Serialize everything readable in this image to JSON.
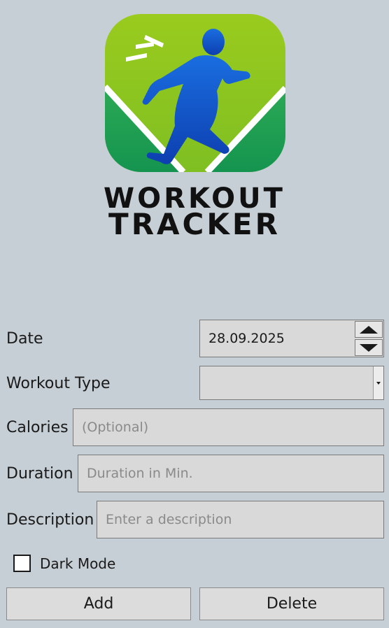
{
  "logo": {
    "line1": "WORKOUT",
    "line2": "TRACKER"
  },
  "form": {
    "date": {
      "label": "Date",
      "value": "28.09.2025"
    },
    "workout_type": {
      "label": "Workout Type",
      "value": ""
    },
    "calories": {
      "label": "Calories",
      "placeholder": "(Optional)"
    },
    "duration": {
      "label": "Duration",
      "placeholder": "Duration in Min."
    },
    "description": {
      "label": "Description",
      "placeholder": "Enter a description"
    },
    "dark_mode": {
      "label": "Dark Mode",
      "checked": false
    }
  },
  "buttons": {
    "add": "Add",
    "delete": "Delete"
  },
  "colors": {
    "background": "#c7cfd6",
    "field_bg": "#d9d9d9",
    "logo_green_light": "#8dc21f",
    "logo_green_dark": "#1fa05a",
    "logo_runner_blue": "#1358c9"
  },
  "icons": {
    "logo": "runner-icon",
    "spin_up": "triangle-up-icon",
    "spin_down": "triangle-down-icon",
    "combo": "chevron-down-icon"
  }
}
